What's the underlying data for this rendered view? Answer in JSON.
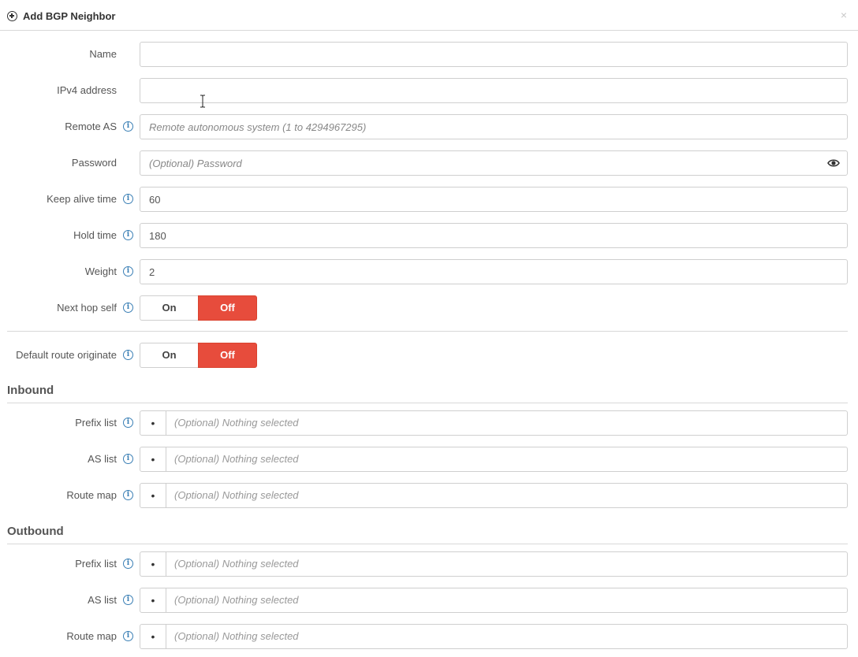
{
  "dialog": {
    "title": "Add BGP Neighbor",
    "close": "×"
  },
  "fields": {
    "name": {
      "label": "Name",
      "value": "",
      "placeholder": ""
    },
    "ipv4": {
      "label": "IPv4 address",
      "value": "",
      "placeholder": ""
    },
    "remote_as": {
      "label": "Remote AS",
      "value": "",
      "placeholder": "Remote autonomous system (1 to 4294967295)"
    },
    "password": {
      "label": "Password",
      "value": "",
      "placeholder": "(Optional) Password"
    },
    "keep_alive": {
      "label": "Keep alive time",
      "value": "60"
    },
    "hold_time": {
      "label": "Hold time",
      "value": "180"
    },
    "weight": {
      "label": "Weight",
      "value": "2"
    },
    "next_hop_self": {
      "label": "Next hop self",
      "on": "On",
      "off": "Off",
      "selected": "Off"
    },
    "default_route": {
      "label": "Default route originate",
      "on": "On",
      "off": "Off",
      "selected": "Off"
    }
  },
  "inbound": {
    "title": "Inbound",
    "prefix_list": {
      "label": "Prefix list",
      "dot": "•",
      "value": "(Optional) Nothing selected"
    },
    "as_list": {
      "label": "AS list",
      "dot": "•",
      "value": "(Optional) Nothing selected"
    },
    "route_map": {
      "label": "Route map",
      "dot": "•",
      "value": "(Optional) Nothing selected"
    }
  },
  "outbound": {
    "title": "Outbound",
    "prefix_list": {
      "label": "Prefix list",
      "dot": "•",
      "value": "(Optional) Nothing selected"
    },
    "as_list": {
      "label": "AS list",
      "dot": "•",
      "value": "(Optional) Nothing selected"
    },
    "route_map": {
      "label": "Route map",
      "dot": "•",
      "value": "(Optional) Nothing selected"
    }
  },
  "info_glyph": "i",
  "colors": {
    "off_active": "#e74c3c",
    "info": "#3a7fb5"
  }
}
